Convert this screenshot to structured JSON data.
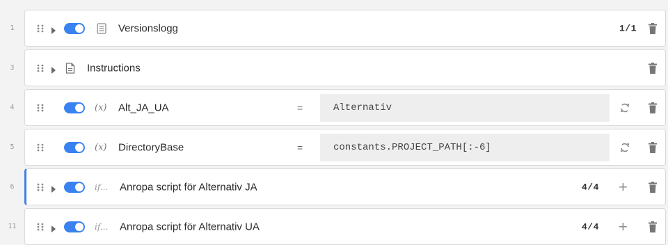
{
  "colors": {
    "accent": "#3a82f0",
    "active_border": "#3f7fe0"
  },
  "rows": [
    {
      "line": "1",
      "label": "Versionslogg",
      "count": "1/1",
      "icon": "doc-list-icon",
      "toggle": true,
      "expandable": true
    },
    {
      "line": "3",
      "label": "Instructions",
      "icon": "doc-icon",
      "toggle": false,
      "expandable": true
    },
    {
      "line": "4",
      "label": "Alt_JA_UA",
      "var_symbol": "(x)",
      "equals": "=",
      "value": "Alternativ",
      "toggle": true,
      "expandable": false
    },
    {
      "line": "5",
      "label": "DirectoryBase",
      "var_symbol": "(x)",
      "equals": "=",
      "value": "constants.PROJECT_PATH[:-6]",
      "toggle": true,
      "expandable": false
    },
    {
      "line": "6",
      "label": "Anropa script för Alternativ JA",
      "if_symbol": "if...",
      "count": "4/4",
      "toggle": true,
      "expandable": true,
      "active": true
    },
    {
      "line": "11",
      "label": "Anropa script för Alternativ UA",
      "if_symbol": "if...",
      "count": "4/4",
      "toggle": true,
      "expandable": true
    }
  ]
}
